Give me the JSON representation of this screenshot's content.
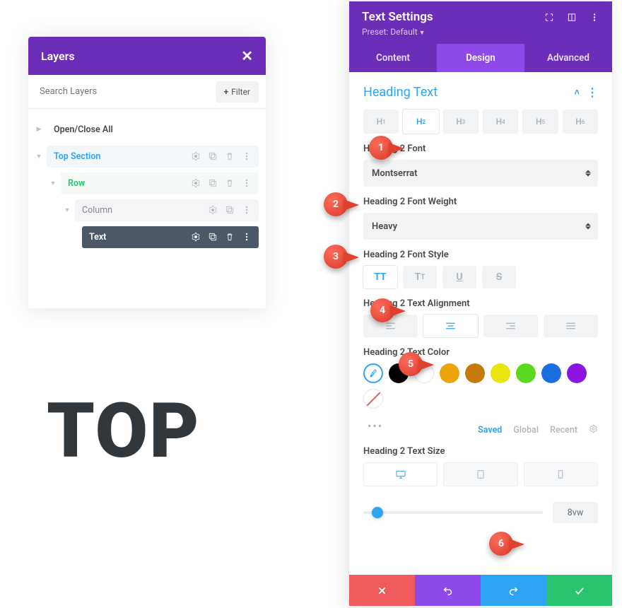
{
  "layers": {
    "title": "Layers",
    "search_placeholder": "Search Layers",
    "filter_label": "Filter",
    "open_close": "Open/Close All",
    "items": {
      "section": "Top Section",
      "row": "Row",
      "column": "Column",
      "text": "Text"
    }
  },
  "preview": {
    "text": "TOP"
  },
  "settings": {
    "title": "Text Settings",
    "preset_label": "Preset: Default",
    "tabs": {
      "content": "Content",
      "design": "Design",
      "advanced": "Advanced"
    },
    "section_title": "Heading Text",
    "heading_levels": [
      "H",
      "H",
      "H",
      "H",
      "H",
      "H"
    ],
    "heading_subs": [
      "1",
      "2",
      "3",
      "4",
      "5",
      "6"
    ],
    "heading_active_index": 1,
    "font_label": "Heading 2 Font",
    "font_value": "Montserrat",
    "weight_label": "Heading 2 Font Weight",
    "weight_value": "Heavy",
    "style_label": "Heading 2 Font Style",
    "align_label": "Heading 2 Text Alignment",
    "color_label": "Heading 2 Text Color",
    "color_swatches": [
      "#000000",
      "#ffffff",
      "#eda409",
      "#c6790a",
      "#e9e40e",
      "#5bd81f",
      "#1a6fe0",
      "#8e15e0"
    ],
    "color_tabs": {
      "saved": "Saved",
      "global": "Global",
      "recent": "Recent"
    },
    "size_label": "Heading 2 Text Size",
    "size_value": "8vw",
    "slider_percent": 8
  },
  "pointers": [
    "1",
    "2",
    "3",
    "4",
    "5",
    "6"
  ]
}
